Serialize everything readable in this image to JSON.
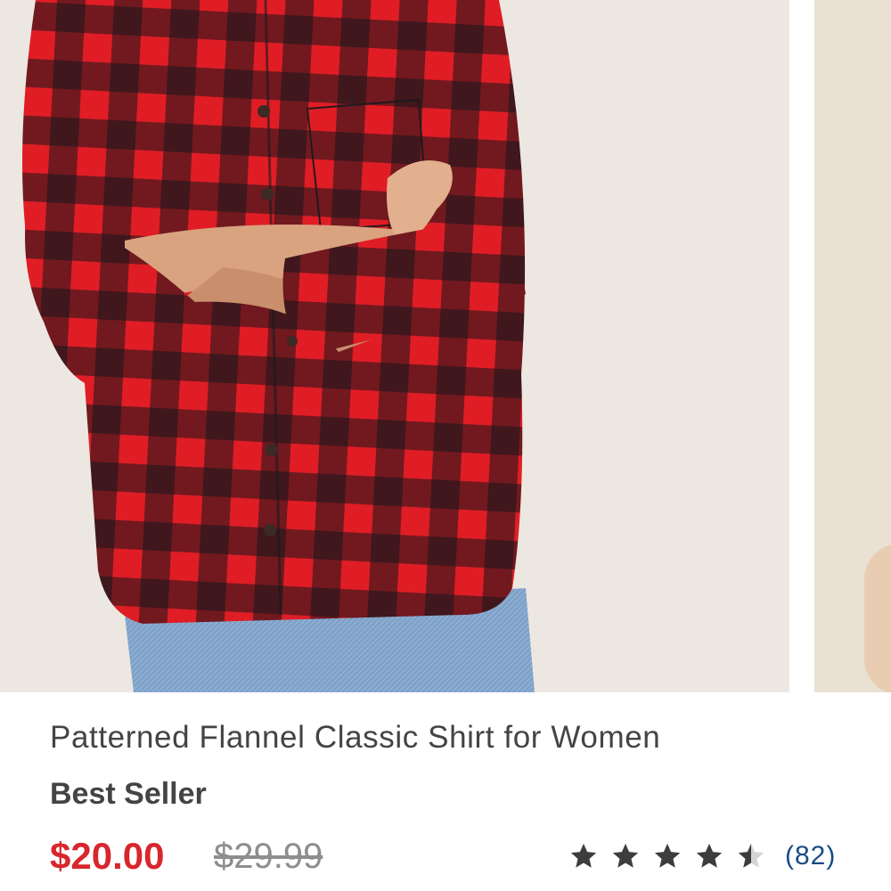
{
  "product": {
    "name": "Patterned Flannel Classic Shirt for Women",
    "badge": "Best Seller",
    "sale_price": "$20.00",
    "original_price": "$29.99",
    "rating": 4.5,
    "max_rating": 5,
    "review_count": "(82)"
  },
  "colors": {
    "sale_price": "#d8262c",
    "original_price": "#8e8e8e",
    "review_count": "#1a4b84",
    "plaid_red": "#e01d25",
    "plaid_black": "#16151a"
  },
  "icons": {
    "star": "star-icon",
    "half_star": "star-half-icon"
  }
}
